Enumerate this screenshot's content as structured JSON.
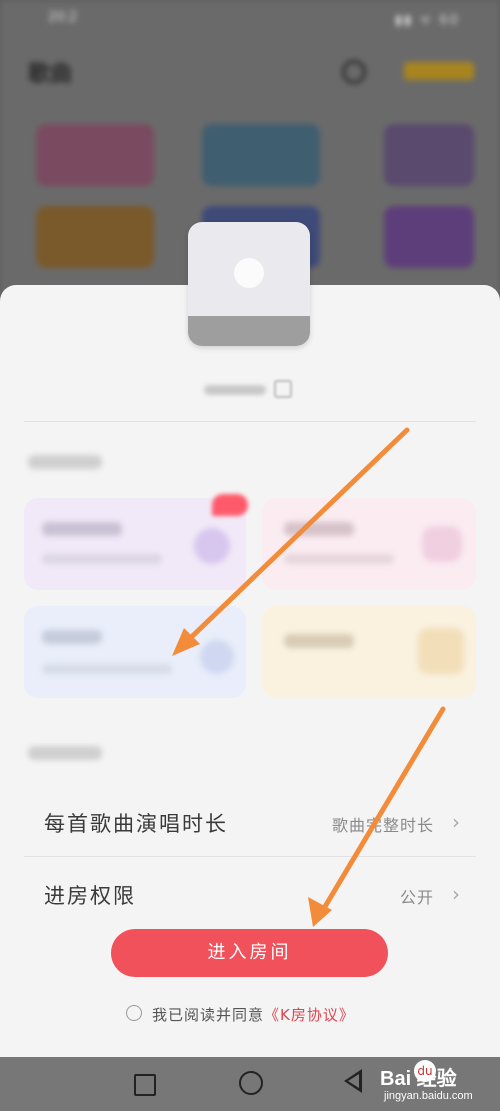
{
  "status_bar": {
    "time": "20:2",
    "icons": "▮▮ ᯤ 60"
  },
  "background": {
    "title": "歌曲"
  },
  "settings": [
    {
      "label": "每首歌曲演唱时长",
      "value": "歌曲完整时长",
      "chevron": "›"
    },
    {
      "label": "进房权限",
      "value": "公开",
      "chevron": "›"
    }
  ],
  "enter_button": {
    "label": "进入房间"
  },
  "agreement": {
    "prefix": "我已阅读并同意",
    "link": "《K房协议》"
  },
  "watermark": {
    "brand": "Bai  经验",
    "paw": "du",
    "site": "jingyan.baidu.com"
  },
  "colors": {
    "accent": "#f0515a",
    "arrow": "#f28c3a",
    "link": "#e0454f"
  },
  "icons": [
    "edit-icon",
    "chevron-right-icon",
    "checkbox-icon",
    "square-nav-icon",
    "home-circle-icon",
    "back-triangle-icon",
    "paw-icon"
  ]
}
